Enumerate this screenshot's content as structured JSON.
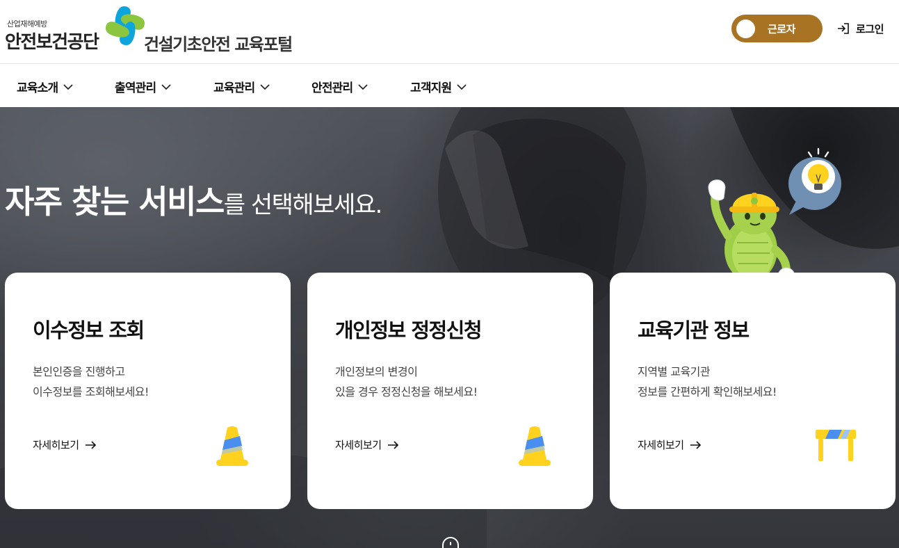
{
  "header": {
    "org_small": "산업재해예방",
    "org_name": "안전보건공단",
    "portal_name": "건설기초안전 교육포털",
    "role_toggle_label": "근로자",
    "login_label": "로그인"
  },
  "nav": {
    "items": [
      {
        "label": "교육소개"
      },
      {
        "label": "출역관리"
      },
      {
        "label": "교육관리"
      },
      {
        "label": "안전관리"
      },
      {
        "label": "고객지원"
      }
    ]
  },
  "hero": {
    "title_strong": "자주 찾는 서비스",
    "title_rest": "를 선택해보세요."
  },
  "cards": [
    {
      "title": "이수정보 조회",
      "desc_line1": "본인인증을 진행하고",
      "desc_line2": "이수정보를 조회해보세요!",
      "more_label": "자세히보기",
      "icon": "traffic-cone-icon"
    },
    {
      "title": "개인정보 정정신청",
      "desc_line1": "개인정보의 변경이",
      "desc_line2": "있을 경우 정정신청을 해보세요!",
      "more_label": "자세히보기",
      "icon": "traffic-cone-icon"
    },
    {
      "title": "교육기관 정보",
      "desc_line1": "지역별 교육기관",
      "desc_line2": "정보를 간편하게 확인해보세요!",
      "more_label": "자세히보기",
      "icon": "safety-barrier-icon"
    }
  ],
  "colors": {
    "toggle_bg": "#a87423",
    "logo_green": "#8cc63f",
    "logo_blue": "#0ea5dd",
    "cone_yellow": "#ffd21f",
    "cone_blue": "#4a8ff0"
  }
}
